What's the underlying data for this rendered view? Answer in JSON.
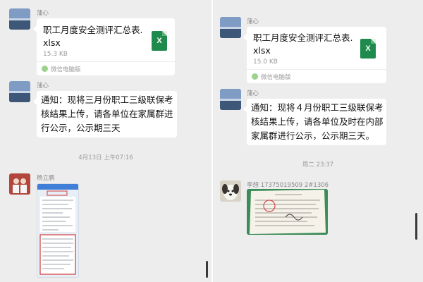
{
  "left": {
    "messages": [
      {
        "sender": "蒲心",
        "file_name_line1": "职工月度安全测评汇总表.",
        "file_name_line2": "xlsx",
        "file_size": "15.3 KB",
        "source": "微信电脑版"
      },
      {
        "sender": "蒲心",
        "text_lines": [
          "通知：现将三月份职工三级联保考",
          "核结果上传，请各单位在家属群进",
          "行公示，公示期三天"
        ]
      },
      {
        "sender": "杨立鹏"
      }
    ],
    "timestamp": "4月13日 上午07:16"
  },
  "right": {
    "messages": [
      {
        "sender": "蒲心",
        "file_name_line1": "职工月度安全测评汇总表.",
        "file_name_line2": "xlsx",
        "file_size": "15.0 KB",
        "source": "微信电脑版"
      },
      {
        "sender": "蒲心",
        "text_lines": [
          "通知：现将４月份职工三级联保考",
          "核结果上传，请各单位及时在内部",
          "家属群进行公示，公示期三天。"
        ]
      },
      {
        "sender": "李想 17375019509 2#1306"
      }
    ],
    "timestamp": "周二 23:37"
  },
  "icons": {
    "excel": "excel-file-icon",
    "wechat": "wechat-icon"
  },
  "colors": {
    "chat_bg": "#ededed",
    "excel_green": "#1e8a4c",
    "bubble": "#ffffff"
  }
}
